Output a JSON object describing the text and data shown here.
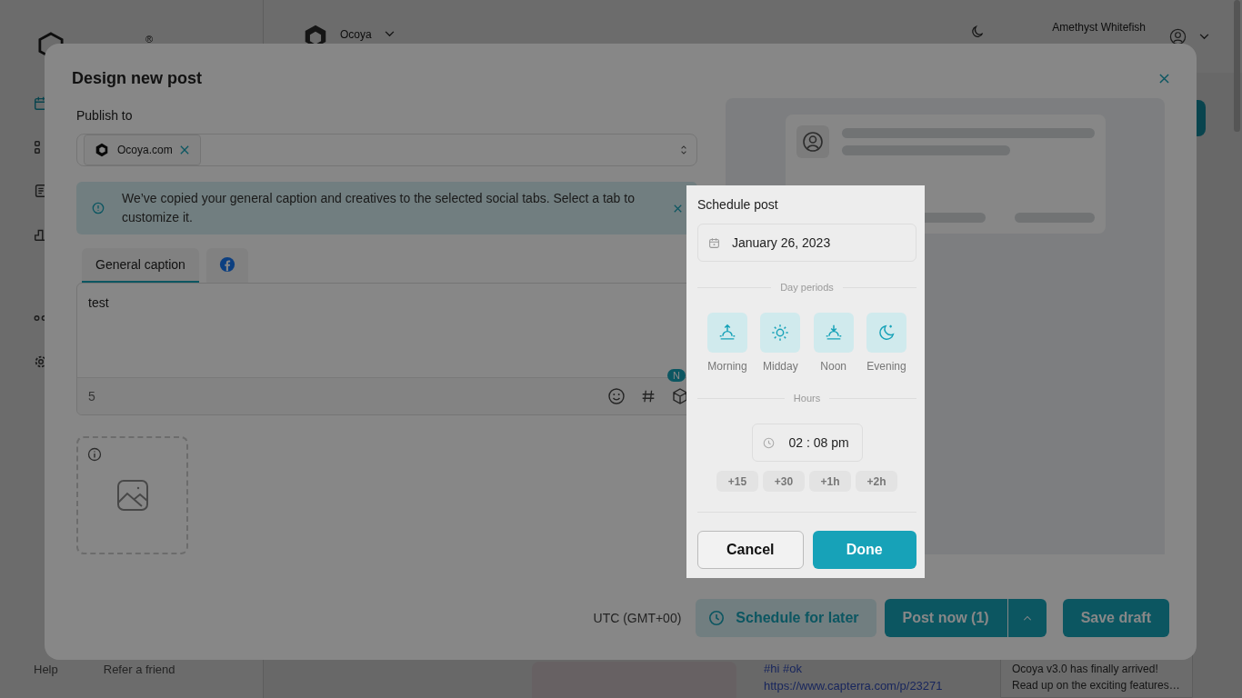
{
  "app": {
    "logo": {
      "mark": "®"
    },
    "workspace": {
      "name": "Ocoya"
    },
    "user": {
      "name": "Amethyst Whitefish"
    },
    "sidebar_footer": {
      "help": "Help",
      "refer": "Refer a friend"
    },
    "feed": {
      "tags": "#hi #ok",
      "link": "https://www.capterra.com/p/23271"
    },
    "news": {
      "title": "Ocoya v3.0 has finally arrived!",
      "text": "Read up on the exciting features…"
    }
  },
  "modal": {
    "title": "Design new post",
    "publish_to": {
      "label": "Publish to",
      "chips": [
        {
          "name": "Ocoya.com"
        }
      ]
    },
    "notice": "We’ve copied your general caption and creatives to the selected social tabs. Select a tab to customize it.",
    "tabs": [
      {
        "kind": "text",
        "label": "General caption",
        "selected": true
      },
      {
        "kind": "facebook",
        "selected": false
      }
    ],
    "caption": {
      "value": "test",
      "count": "5",
      "badge": "N"
    },
    "timezone": "UTC (GMT+00)",
    "schedule_button": "Schedule for later",
    "post_button": "Post now (1)",
    "draft_button": "Save draft"
  },
  "schedule": {
    "title": "Schedule post",
    "date": "January 26, 2023",
    "periods_label": "Day periods",
    "periods": [
      {
        "kind": "sunrise",
        "label": "Morning"
      },
      {
        "kind": "sun",
        "label": "Midday"
      },
      {
        "kind": "sunset",
        "label": "Noon"
      },
      {
        "kind": "moon",
        "label": "Evening"
      }
    ],
    "hours_label": "Hours",
    "time": "02 : 08 pm",
    "increments": [
      "+15",
      "+30",
      "+1h",
      "+2h"
    ],
    "cancel": "Cancel",
    "done": "Done"
  }
}
